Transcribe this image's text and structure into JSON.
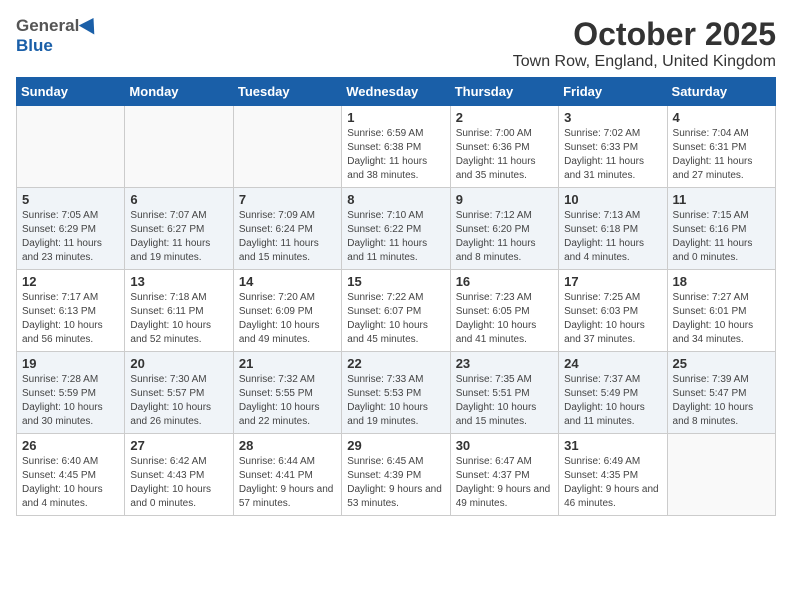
{
  "header": {
    "logo_general": "General",
    "logo_blue": "Blue",
    "month": "October 2025",
    "location": "Town Row, England, United Kingdom"
  },
  "weekdays": [
    "Sunday",
    "Monday",
    "Tuesday",
    "Wednesday",
    "Thursday",
    "Friday",
    "Saturday"
  ],
  "weeks": [
    [
      {
        "day": "",
        "info": ""
      },
      {
        "day": "",
        "info": ""
      },
      {
        "day": "",
        "info": ""
      },
      {
        "day": "1",
        "info": "Sunrise: 6:59 AM\nSunset: 6:38 PM\nDaylight: 11 hours\nand 38 minutes."
      },
      {
        "day": "2",
        "info": "Sunrise: 7:00 AM\nSunset: 6:36 PM\nDaylight: 11 hours\nand 35 minutes."
      },
      {
        "day": "3",
        "info": "Sunrise: 7:02 AM\nSunset: 6:33 PM\nDaylight: 11 hours\nand 31 minutes."
      },
      {
        "day": "4",
        "info": "Sunrise: 7:04 AM\nSunset: 6:31 PM\nDaylight: 11 hours\nand 27 minutes."
      }
    ],
    [
      {
        "day": "5",
        "info": "Sunrise: 7:05 AM\nSunset: 6:29 PM\nDaylight: 11 hours\nand 23 minutes."
      },
      {
        "day": "6",
        "info": "Sunrise: 7:07 AM\nSunset: 6:27 PM\nDaylight: 11 hours\nand 19 minutes."
      },
      {
        "day": "7",
        "info": "Sunrise: 7:09 AM\nSunset: 6:24 PM\nDaylight: 11 hours\nand 15 minutes."
      },
      {
        "day": "8",
        "info": "Sunrise: 7:10 AM\nSunset: 6:22 PM\nDaylight: 11 hours\nand 11 minutes."
      },
      {
        "day": "9",
        "info": "Sunrise: 7:12 AM\nSunset: 6:20 PM\nDaylight: 11 hours\nand 8 minutes."
      },
      {
        "day": "10",
        "info": "Sunrise: 7:13 AM\nSunset: 6:18 PM\nDaylight: 11 hours\nand 4 minutes."
      },
      {
        "day": "11",
        "info": "Sunrise: 7:15 AM\nSunset: 6:16 PM\nDaylight: 11 hours\nand 0 minutes."
      }
    ],
    [
      {
        "day": "12",
        "info": "Sunrise: 7:17 AM\nSunset: 6:13 PM\nDaylight: 10 hours\nand 56 minutes."
      },
      {
        "day": "13",
        "info": "Sunrise: 7:18 AM\nSunset: 6:11 PM\nDaylight: 10 hours\nand 52 minutes."
      },
      {
        "day": "14",
        "info": "Sunrise: 7:20 AM\nSunset: 6:09 PM\nDaylight: 10 hours\nand 49 minutes."
      },
      {
        "day": "15",
        "info": "Sunrise: 7:22 AM\nSunset: 6:07 PM\nDaylight: 10 hours\nand 45 minutes."
      },
      {
        "day": "16",
        "info": "Sunrise: 7:23 AM\nSunset: 6:05 PM\nDaylight: 10 hours\nand 41 minutes."
      },
      {
        "day": "17",
        "info": "Sunrise: 7:25 AM\nSunset: 6:03 PM\nDaylight: 10 hours\nand 37 minutes."
      },
      {
        "day": "18",
        "info": "Sunrise: 7:27 AM\nSunset: 6:01 PM\nDaylight: 10 hours\nand 34 minutes."
      }
    ],
    [
      {
        "day": "19",
        "info": "Sunrise: 7:28 AM\nSunset: 5:59 PM\nDaylight: 10 hours\nand 30 minutes."
      },
      {
        "day": "20",
        "info": "Sunrise: 7:30 AM\nSunset: 5:57 PM\nDaylight: 10 hours\nand 26 minutes."
      },
      {
        "day": "21",
        "info": "Sunrise: 7:32 AM\nSunset: 5:55 PM\nDaylight: 10 hours\nand 22 minutes."
      },
      {
        "day": "22",
        "info": "Sunrise: 7:33 AM\nSunset: 5:53 PM\nDaylight: 10 hours\nand 19 minutes."
      },
      {
        "day": "23",
        "info": "Sunrise: 7:35 AM\nSunset: 5:51 PM\nDaylight: 10 hours\nand 15 minutes."
      },
      {
        "day": "24",
        "info": "Sunrise: 7:37 AM\nSunset: 5:49 PM\nDaylight: 10 hours\nand 11 minutes."
      },
      {
        "day": "25",
        "info": "Sunrise: 7:39 AM\nSunset: 5:47 PM\nDaylight: 10 hours\nand 8 minutes."
      }
    ],
    [
      {
        "day": "26",
        "info": "Sunrise: 6:40 AM\nSunset: 4:45 PM\nDaylight: 10 hours\nand 4 minutes."
      },
      {
        "day": "27",
        "info": "Sunrise: 6:42 AM\nSunset: 4:43 PM\nDaylight: 10 hours\nand 0 minutes."
      },
      {
        "day": "28",
        "info": "Sunrise: 6:44 AM\nSunset: 4:41 PM\nDaylight: 9 hours\nand 57 minutes."
      },
      {
        "day": "29",
        "info": "Sunrise: 6:45 AM\nSunset: 4:39 PM\nDaylight: 9 hours\nand 53 minutes."
      },
      {
        "day": "30",
        "info": "Sunrise: 6:47 AM\nSunset: 4:37 PM\nDaylight: 9 hours\nand 49 minutes."
      },
      {
        "day": "31",
        "info": "Sunrise: 6:49 AM\nSunset: 4:35 PM\nDaylight: 9 hours\nand 46 minutes."
      },
      {
        "day": "",
        "info": ""
      }
    ]
  ]
}
